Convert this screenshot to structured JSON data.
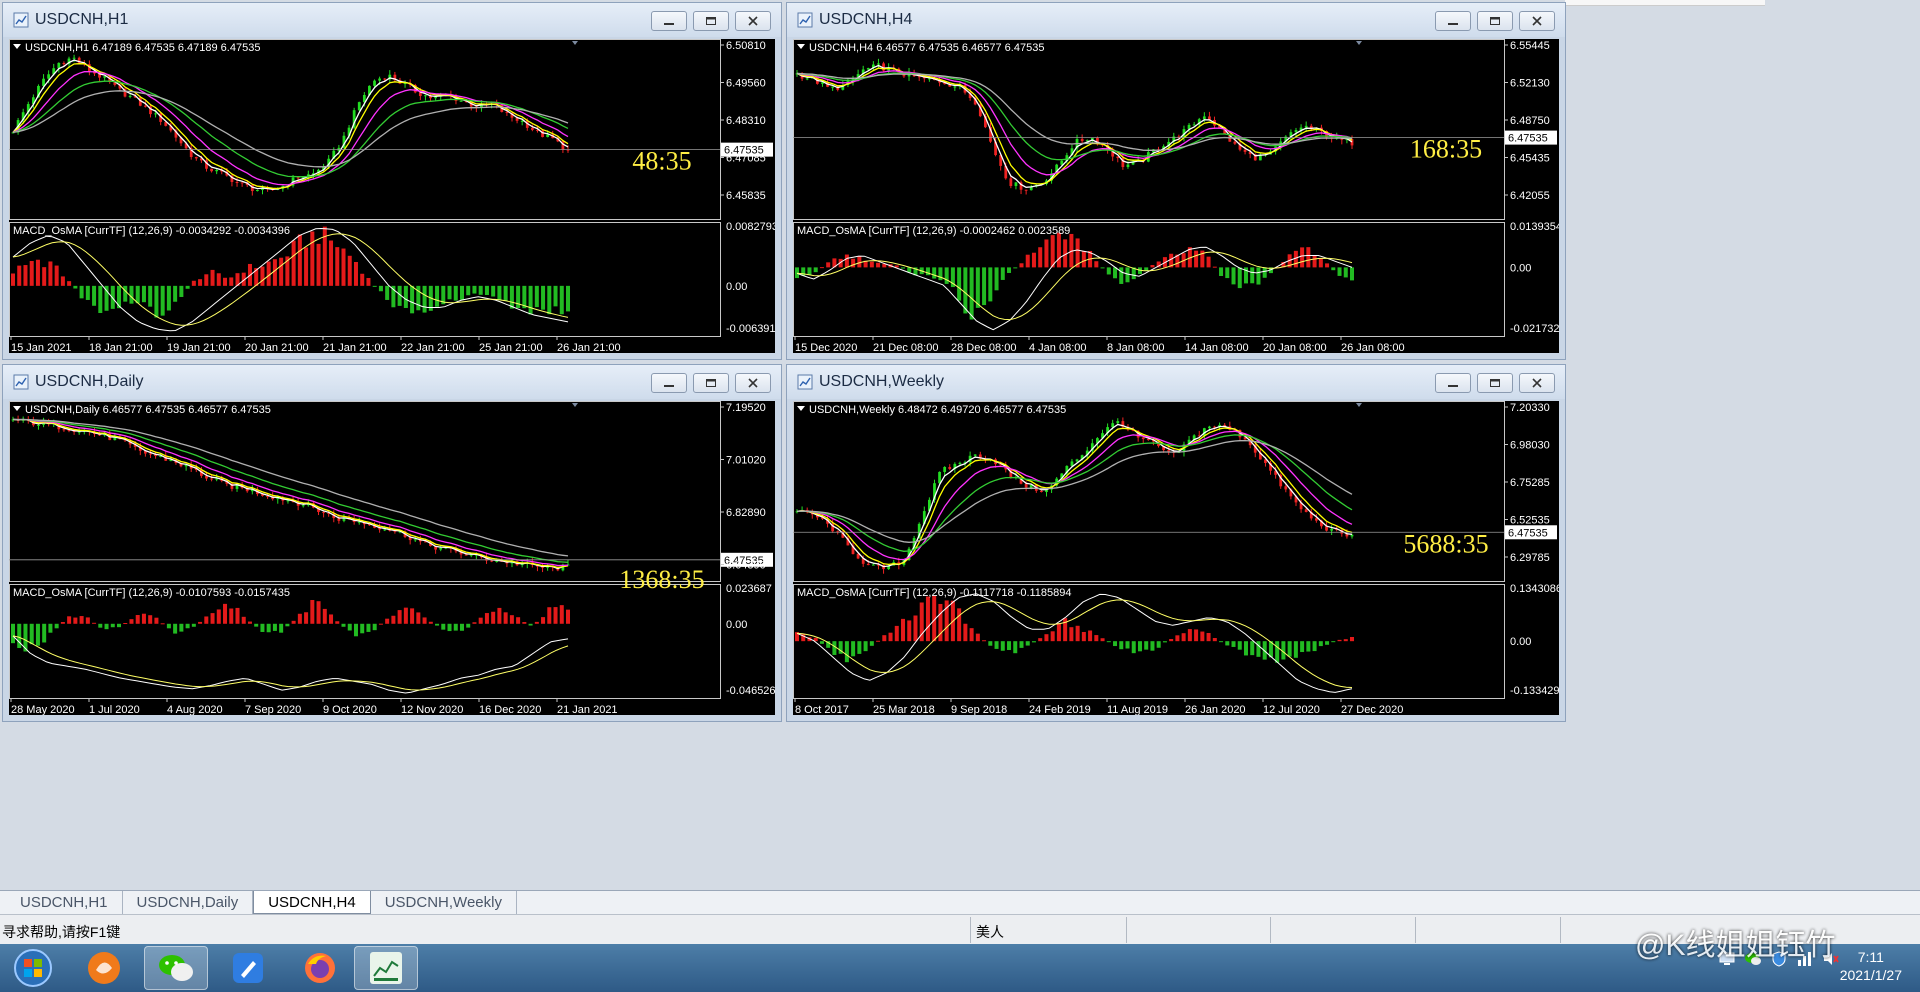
{
  "colors": {
    "fast_ma": "#ffffff",
    "ma2": "#ffff00",
    "ma3": "#ff33ff",
    "ma4": "#33cc33",
    "ma5": "#b0b0b0",
    "bull": "#22dd22",
    "bear": "#ee2222",
    "hist_up": "#e41a1a",
    "hist_down": "#22bb22",
    "countdown": "#ffee44"
  },
  "windows": [
    {
      "title": "USDCNH,H1",
      "header": "USDCNH,H1  6.47189 6.47535 6.47189 6.47535",
      "countdown": "48:35",
      "price_labels": [
        "6.50810",
        "6.49560",
        "6.48310",
        "6.47085",
        "6.45835"
      ],
      "current_price": "6.47535",
      "current_frac": 0.62,
      "macd_header": "MACD_OsMA [CurrTF] (12,26,9) -0.0034292 -0.0034396",
      "macd_labels": [
        "0.0082793",
        "0.00",
        "-0.006391"
      ],
      "time_labels": [
        "15 Jan 2021",
        "18 Jan 21:00",
        "19 Jan 21:00",
        "20 Jan 21:00",
        "21 Jan 21:00",
        "22 Jan 21:00",
        "25 Jan 21:00",
        "26 Jan 21:00"
      ],
      "chart_data": {
        "type": "line",
        "title": "USDCNH,H1  6.47189 6.47535 6.47189 6.47535",
        "y_ticks": [
          6.5081,
          6.4956,
          6.4831,
          6.47085,
          6.45835
        ],
        "ylim": [
          6.452,
          6.511
        ],
        "series": [
          {
            "name": "close",
            "values": [
              6.481,
              6.49,
              6.498,
              6.504,
              6.506,
              6.502,
              6.499,
              6.495,
              6.492,
              6.488,
              6.484,
              6.478,
              6.472,
              6.468,
              6.466,
              6.463,
              6.461,
              6.46,
              6.462,
              6.465,
              6.466,
              6.47,
              6.478,
              6.49,
              6.498,
              6.5,
              6.497,
              6.494,
              6.492,
              6.493,
              6.491,
              6.489,
              6.49,
              6.486,
              6.484,
              6.48,
              6.478,
              6.474
            ]
          }
        ]
      },
      "macd_data": {
        "ylim": [
          -0.0064,
          0.0083
        ],
        "histogram": [
          0.002,
          0.003,
          0.0035,
          0.001,
          -0.002,
          -0.004,
          -0.003,
          -0.002,
          -0.004,
          -0.003,
          0.0005,
          0.002,
          0.001,
          0.0025,
          0.003,
          0.004,
          0.006,
          0.0075,
          0.006,
          0.004,
          0.0005,
          -0.002,
          -0.004,
          -0.0035,
          -0.0025,
          -0.002,
          -0.001,
          -0.0015,
          -0.003,
          -0.004,
          -0.0034,
          -0.0034
        ],
        "signal": [
          0.004,
          0.006,
          0.007,
          0.006,
          0.003,
          0.0,
          -0.003,
          -0.005,
          -0.006,
          -0.0063,
          -0.005,
          -0.003,
          -0.001,
          0.001,
          0.003,
          0.005,
          0.007,
          0.008,
          0.0078,
          0.006,
          0.003,
          0.0,
          -0.002,
          -0.003,
          -0.003,
          -0.002,
          -0.0015,
          -0.002,
          -0.003,
          -0.004,
          -0.0045,
          -0.005
        ]
      }
    },
    {
      "title": "USDCNH,H4",
      "header": "USDCNH,H4  6.46577 6.47535 6.46577 6.47535",
      "countdown": "168:35",
      "price_labels": [
        "6.55445",
        "6.52130",
        "6.48750",
        "6.45435",
        "6.42055"
      ],
      "current_price": "6.47535",
      "current_frac": 0.55,
      "macd_header": "MACD_OsMA [CurrTF] (12,26,9) -0.0002462 0.0023589",
      "macd_labels": [
        "0.0139354",
        "0.00",
        "-0.0217328"
      ],
      "time_labels": [
        "15 Dec 2020",
        "21 Dec 08:00",
        "28 Dec 08:00",
        "4 Jan 08:00",
        "8 Jan 08:00",
        "14 Jan 08:00",
        "20 Jan 08:00",
        "26 Jan 08:00"
      ],
      "chart_data": {
        "type": "line",
        "title": "USDCNH,H4  6.46577 6.47535 6.46577 6.47535",
        "y_ticks": [
          6.55445,
          6.5213,
          6.4875,
          6.45435,
          6.42055
        ],
        "ylim": [
          6.412,
          6.562
        ],
        "series": [
          {
            "name": "close",
            "values": [
              6.535,
              6.53,
              6.522,
              6.525,
              6.538,
              6.542,
              6.537,
              6.533,
              6.53,
              6.528,
              6.523,
              6.51,
              6.47,
              6.44,
              6.435,
              6.44,
              6.455,
              6.475,
              6.48,
              6.47,
              6.455,
              6.458,
              6.47,
              6.478,
              6.488,
              6.5,
              6.485,
              6.47,
              6.462,
              6.465,
              6.48,
              6.49,
              6.485,
              6.478,
              6.475
            ]
          }
        ]
      },
      "macd_data": {
        "ylim": [
          -0.0217,
          0.0139
        ],
        "histogram": [
          -0.003,
          -0.002,
          0.002,
          0.004,
          0.003,
          0.0015,
          0.001,
          -0.002,
          -0.003,
          -0.004,
          -0.012,
          -0.018,
          -0.008,
          -0.002,
          0.003,
          0.008,
          0.012,
          0.009,
          0.005,
          -0.002,
          -0.006,
          -0.003,
          0.002,
          0.004,
          0.007,
          0.005,
          -0.003,
          -0.007,
          -0.006,
          -0.002,
          0.003,
          0.008,
          0.004,
          -0.002,
          -0.004
        ],
        "signal": [
          -0.002,
          -0.004,
          -0.001,
          0.003,
          0.004,
          0.002,
          0.0,
          -0.002,
          -0.004,
          -0.006,
          -0.012,
          -0.018,
          -0.021,
          -0.018,
          -0.012,
          -0.004,
          0.003,
          0.006,
          0.005,
          0.002,
          -0.002,
          -0.003,
          0.0,
          0.003,
          0.006,
          0.007,
          0.004,
          0.0,
          -0.002,
          -0.001,
          0.002,
          0.004,
          0.004,
          0.002,
          0.0
        ]
      }
    },
    {
      "title": "USDCNH,Daily",
      "header": "USDCNH,Daily  6.46577 6.47535 6.46577 6.47535",
      "countdown": "1368:35",
      "price_labels": [
        "7.19520",
        "7.01020",
        "6.82890",
        "6.64390"
      ],
      "current_price": "6.47535",
      "current_frac": 0.9,
      "macd_header": "MACD_OsMA [CurrTF] (12,26,9) -0.0107593 -0.0157435",
      "macd_labels": [
        "0.023687",
        "0.00",
        "-0.046526"
      ],
      "time_labels": [
        "28 May 2020",
        "1 Jul 2020",
        "4 Aug 2020",
        "7 Sep 2020",
        "9 Oct 2020",
        "12 Nov 2020",
        "16 Dec 2020",
        "21 Jan 2021"
      ],
      "chart_data": {
        "type": "line",
        "title": "USDCNH,Daily  6.46577 6.47535 6.46577 6.47535",
        "y_ticks": [
          7.1952,
          7.0102,
          6.8289,
          6.6439
        ],
        "ylim": [
          6.43,
          7.22
        ],
        "series": [
          {
            "name": "close",
            "values": [
              7.15,
              7.14,
              7.128,
              7.115,
              7.1,
              7.08,
              7.055,
              7.01,
              6.985,
              6.96,
              6.925,
              6.88,
              6.85,
              6.835,
              6.81,
              6.79,
              6.77,
              6.74,
              6.7,
              6.69,
              6.67,
              6.65,
              6.62,
              6.58,
              6.56,
              6.54,
              6.52,
              6.505,
              6.495,
              6.48,
              6.47,
              6.475
            ]
          }
        ]
      },
      "macd_data": {
        "ylim": [
          -0.0465,
          0.0237
        ],
        "histogram": [
          -0.012,
          -0.018,
          -0.008,
          0.004,
          0.006,
          -0.004,
          -0.002,
          0.007,
          0.004,
          -0.006,
          -0.003,
          0.006,
          0.015,
          0.004,
          -0.006,
          -0.005,
          0.006,
          0.016,
          0.003,
          -0.008,
          -0.006,
          0.005,
          0.012,
          0.004,
          -0.004,
          -0.006,
          0.003,
          0.01,
          0.006,
          -0.002,
          0.01,
          0.012
        ],
        "signal": [
          -0.008,
          -0.02,
          -0.026,
          -0.028,
          -0.03,
          -0.033,
          -0.036,
          -0.038,
          -0.04,
          -0.042,
          -0.043,
          -0.041,
          -0.038,
          -0.036,
          -0.04,
          -0.044,
          -0.042,
          -0.038,
          -0.036,
          -0.038,
          -0.04,
          -0.044,
          -0.046,
          -0.043,
          -0.04,
          -0.036,
          -0.034,
          -0.03,
          -0.028,
          -0.02,
          -0.012,
          -0.01
        ]
      }
    },
    {
      "title": "USDCNH,Weekly",
      "header": "USDCNH,Weekly  6.48472 6.49720 6.46577 6.47535",
      "countdown": "5688:35",
      "price_labels": [
        "7.20330",
        "6.98030",
        "6.75285",
        "6.52535",
        "6.29785"
      ],
      "current_price": "6.47535",
      "current_frac": 0.74,
      "macd_header": "MACD_OsMA [CurrTF] (12,26,9) -0.1117718 -0.1185894",
      "macd_labels": [
        "0.1343086",
        "0.00",
        "-0.1334299"
      ],
      "time_labels": [
        "8 Oct 2017",
        "25 Mar 2018",
        "9 Sep 2018",
        "24 Feb 2019",
        "11 Aug 2019",
        "26 Jan 2020",
        "12 Jul 2020",
        "27 Dec 2020"
      ],
      "chart_data": {
        "type": "line",
        "title": "USDCNH,Weekly  6.48472 6.49720 6.46577 6.47535",
        "y_ticks": [
          7.2033,
          6.9803,
          6.75285,
          6.52535,
          6.29785
        ],
        "ylim": [
          6.24,
          7.24
        ],
        "series": [
          {
            "name": "close",
            "values": [
              6.62,
              6.6,
              6.52,
              6.4,
              6.3,
              6.29,
              6.34,
              6.6,
              6.85,
              6.9,
              6.95,
              6.92,
              6.82,
              6.76,
              6.74,
              6.87,
              6.96,
              7.08,
              7.15,
              7.05,
              7.01,
              6.94,
              7.04,
              7.12,
              7.11,
              7.05,
              6.92,
              6.78,
              6.65,
              6.56,
              6.5,
              6.475
            ]
          }
        ]
      },
      "macd_data": {
        "ylim": [
          -0.1334,
          0.1343
        ],
        "histogram": [
          0.02,
          0.01,
          -0.03,
          -0.05,
          -0.02,
          0.02,
          0.05,
          0.09,
          0.12,
          0.08,
          0.02,
          -0.02,
          -0.03,
          -0.01,
          0.02,
          0.05,
          0.03,
          0.01,
          -0.02,
          -0.03,
          -0.02,
          0.01,
          0.03,
          0.02,
          -0.01,
          -0.03,
          -0.04,
          -0.05,
          -0.04,
          -0.02,
          0.0,
          0.01
        ],
        "signal": [
          0.02,
          0.0,
          -0.04,
          -0.08,
          -0.1,
          -0.08,
          -0.04,
          0.02,
          0.07,
          0.11,
          0.12,
          0.1,
          0.06,
          0.03,
          0.03,
          0.06,
          0.1,
          0.12,
          0.11,
          0.08,
          0.05,
          0.04,
          0.05,
          0.06,
          0.05,
          0.02,
          -0.02,
          -0.06,
          -0.1,
          -0.12,
          -0.13,
          -0.12
        ]
      }
    }
  ],
  "tabs": [
    "USDCNH,H1",
    "USDCNH,Daily",
    "USDCNH,H4",
    "USDCNH,Weekly"
  ],
  "active_tab": 2,
  "status": {
    "help": "寻求帮助,请按F1键",
    "profile": "美人"
  },
  "clock": {
    "time": "7:11",
    "date": "2021/1/27"
  },
  "watermark": "@K线姐姐钰竹"
}
